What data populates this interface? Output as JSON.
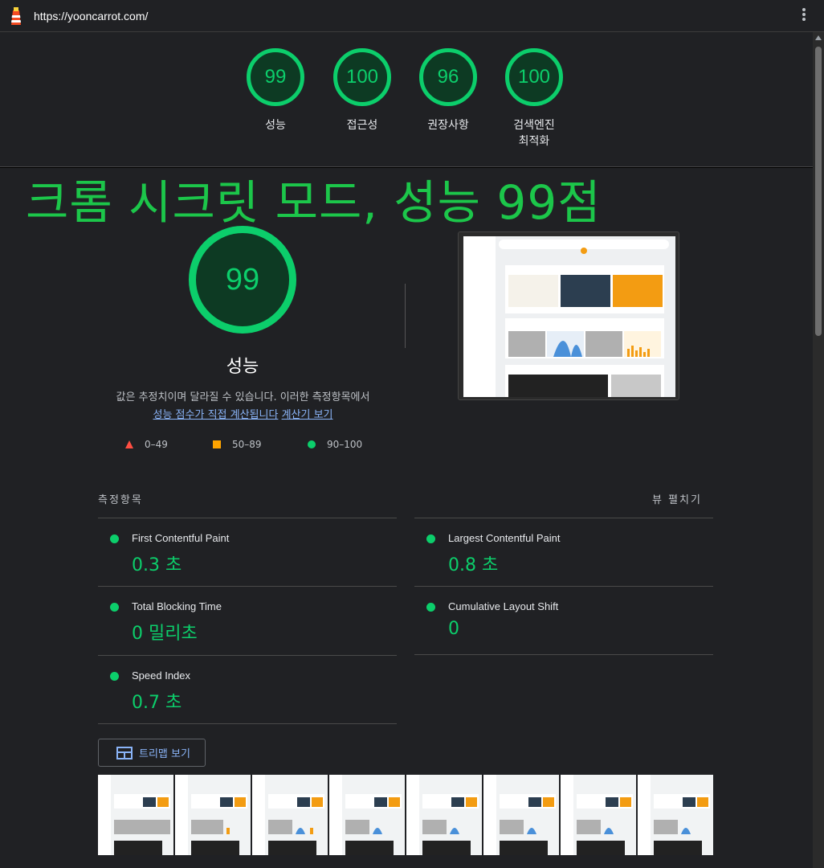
{
  "url": "https://yooncarrot.com/",
  "header_scores": [
    {
      "score": "99",
      "label": "성능"
    },
    {
      "score": "100",
      "label": "접근성"
    },
    {
      "score": "96",
      "label": "권장사항"
    },
    {
      "score": "100",
      "label": "검색엔진\n최적화"
    }
  ],
  "overlay_title": "크롬 시크릿 모드, 성능 99점",
  "performance": {
    "score": "99",
    "title": "성능",
    "description": "값은 추정치이며 달라질 수 있습니다. 이러한 측정항목에서",
    "link1": "성능 점수가 직접 계산됩니다",
    "link2": "계산기 보기"
  },
  "legend": {
    "fail": "0–49",
    "average": "50–89",
    "pass": "90–100"
  },
  "metrics_header": "측정항목",
  "expand_label": "뷰 펼치기",
  "metrics": [
    {
      "name": "First Contentful Paint",
      "value": "0.3 초"
    },
    {
      "name": "Largest Contentful Paint",
      "value": "0.8 초"
    },
    {
      "name": "Total Blocking Time",
      "value": "0 밀리초"
    },
    {
      "name": "Cumulative Layout Shift",
      "value": "0"
    },
    {
      "name": "Speed Index",
      "value": "0.7 초"
    }
  ],
  "treemap_label": "트리맵 보기",
  "colors": {
    "pass": "#0cce6b",
    "average": "#ffa400",
    "fail": "#ff4e42",
    "overlay": "#1cc64a"
  },
  "icons": [
    "lighthouse-icon",
    "kebab-menu-icon",
    "treemap-icon"
  ]
}
